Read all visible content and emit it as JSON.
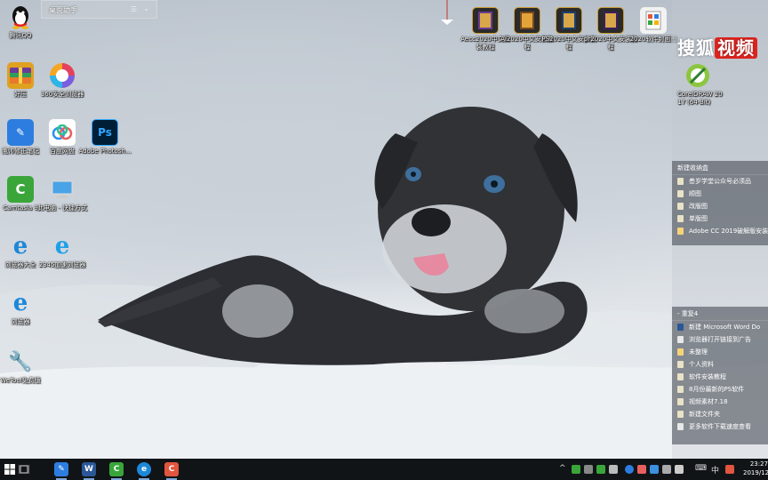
{
  "fence_top": {
    "title": "桌面助手",
    "menu_icon": "list-icon",
    "chevron_icon": "chevron-icon"
  },
  "watermark": {
    "part1": "搜狐",
    "part2": "视频"
  },
  "left_icons": [
    {
      "label": "腾讯QQ",
      "icon": "qq-icon",
      "color": "#111111"
    },
    {
      "label": "好压",
      "icon": "archive-icon",
      "color": "#e0a020"
    },
    {
      "label": "360安全浏览器",
      "icon": "browser-icon",
      "color": "#f0a030"
    },
    {
      "label": "鹰帅修正笔记",
      "icon": "pen-icon",
      "color": "#2d7de0"
    },
    {
      "label": "百度网盘",
      "icon": "cloud-icon",
      "color": "#2d8ff0"
    },
    {
      "label": "Adobe Photosh...",
      "icon": "ps-icon",
      "color": "#001e36"
    },
    {
      "label": "Camtasia 9",
      "icon": "camtasia-icon",
      "color": "#3aa63a"
    },
    {
      "label": "此电脑 - 快捷方式",
      "icon": "computer-icon",
      "color": "#4aa3e6"
    },
    {
      "label": "浏览器大全",
      "icon": "ie-icon",
      "color": "#1e88d8"
    },
    {
      "label": "2345加速浏览器",
      "icon": "ie-icon",
      "color": "#1ea0e8"
    },
    {
      "label": "浏览器",
      "icon": "ie-icon",
      "color": "#1e88d8"
    },
    {
      "label": "WeTool免费版",
      "icon": "wrench-icon",
      "color": "#3d8fe0"
    }
  ],
  "top_icons": [
    {
      "label": "Aecc2020中文安装教程",
      "icon": "folder-icon"
    },
    {
      "label": "Ai2020中文安装教程",
      "icon": "folder-icon"
    },
    {
      "label": "PS2020中文安装教程",
      "icon": "folder-icon"
    },
    {
      "label": "pr2020中文安装教程",
      "icon": "folder-icon"
    },
    {
      "label": "2020软件封面图",
      "icon": "file-icon"
    }
  ],
  "corel_icon": {
    "label": "CorelDRAW 2017 (64-Bit)",
    "icon": "coreldraw-icon"
  },
  "fence_new": {
    "title": "新建收纳盒",
    "items": [
      {
        "label": "叁岁学堂公众号必须品",
        "type": "folder"
      },
      {
        "label": "顺图",
        "type": "folder"
      },
      {
        "label": "改版图",
        "type": "folder"
      },
      {
        "label": "单版图",
        "type": "folder"
      },
      {
        "label": "Adobe CC 2019破解版安装",
        "type": "folder"
      }
    ]
  },
  "fence_dup": {
    "title": "- 重复4",
    "items": [
      {
        "label": "新建 Microsoft Word Do",
        "type": "word"
      },
      {
        "label": "浏览器打开链接到广告",
        "type": "txt"
      },
      {
        "label": "未整理",
        "type": "img"
      },
      {
        "label": "个人资料",
        "type": "folder"
      },
      {
        "label": "软件安装教程",
        "type": "folder"
      },
      {
        "label": "8月份最新的PS软件",
        "type": "folder"
      },
      {
        "label": "视频素材7.18",
        "type": "folder"
      },
      {
        "label": "新建文件夹",
        "type": "folder"
      },
      {
        "label": "更多软件下载速度查看",
        "type": "txt"
      }
    ]
  },
  "taskbar": {
    "start_icon": "windows-logo-icon",
    "task_view_icon": "task-view-icon",
    "apps": [
      {
        "name": "pen-app",
        "glyph": "✎",
        "color": "#2d7de0"
      },
      {
        "name": "word-app",
        "glyph": "W",
        "color": "#2b5797"
      },
      {
        "name": "camtasia-app",
        "glyph": "C",
        "color": "#3aa63a"
      },
      {
        "name": "ie-app",
        "glyph": "e",
        "color": "#1e88d8"
      },
      {
        "name": "red-app",
        "glyph": "C",
        "color": "#e2553e"
      }
    ],
    "ime": "中",
    "clock_time": "23:27",
    "clock_date": "2019/12"
  }
}
